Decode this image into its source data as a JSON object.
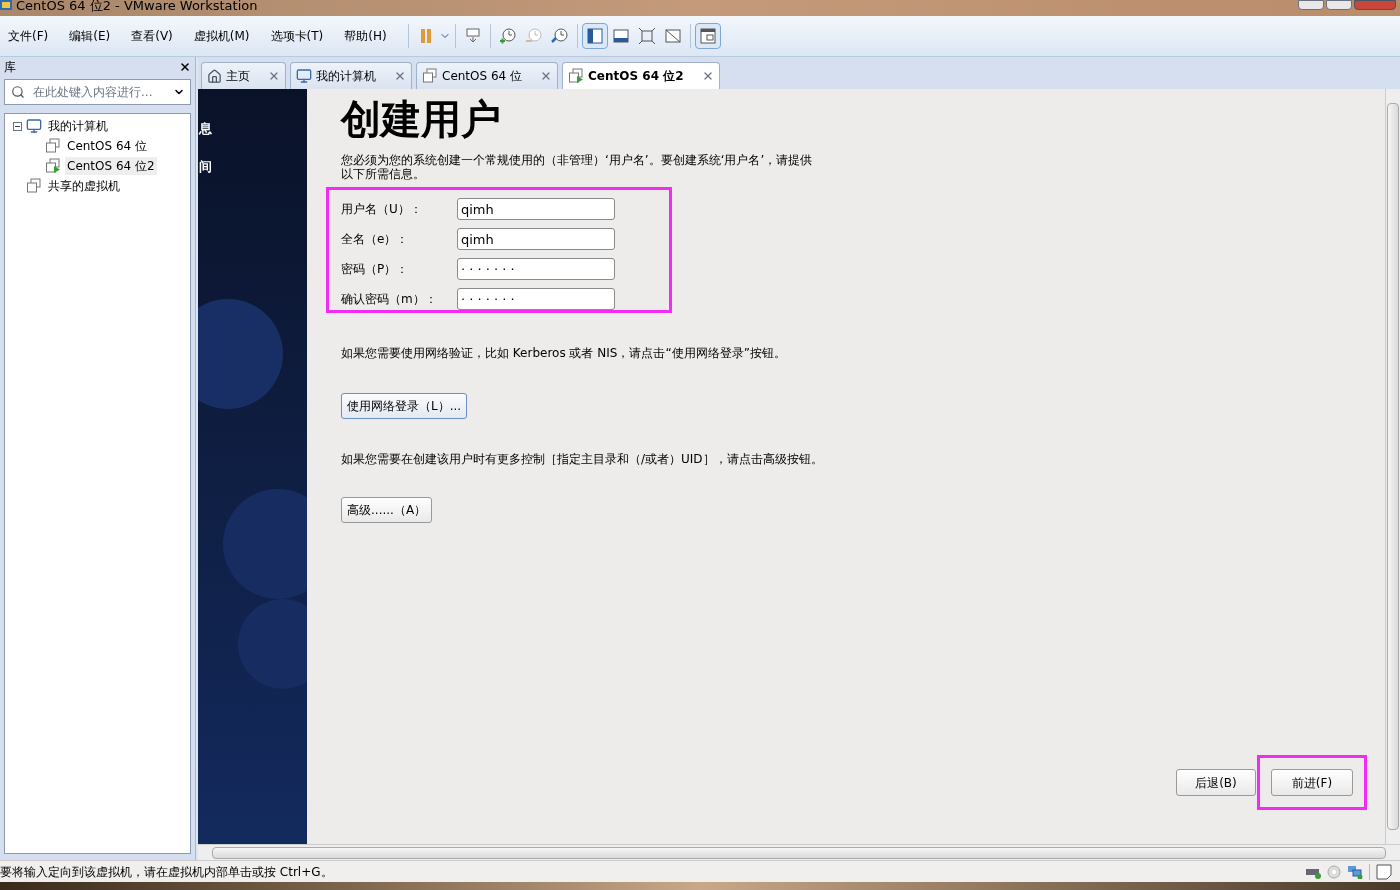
{
  "window": {
    "title": "CentOS 64 位2 - VMware Workstation"
  },
  "menu": [
    "文件(F)",
    "编辑(E)",
    "查看(V)",
    "虚拟机(M)",
    "选项卡(T)",
    "帮助(H)"
  ],
  "library": {
    "title": "库",
    "search": {
      "placeholder": "在此处键入内容进行..."
    },
    "tree": [
      {
        "label": "我的计算机",
        "kind": "computer",
        "expanded": true,
        "selected": false,
        "children": [
          {
            "label": "CentOS 64 位",
            "kind": "vm",
            "selected": false
          },
          {
            "label": "CentOS 64 位2",
            "kind": "vm-running",
            "selected": true
          }
        ]
      },
      {
        "label": "共享的虚拟机",
        "kind": "shared",
        "selected": false
      }
    ]
  },
  "tabs": [
    {
      "label": "主页",
      "kind": "home",
      "selected": false
    },
    {
      "label": "我的计算机",
      "kind": "computer",
      "selected": false
    },
    {
      "label": "CentOS 64 位",
      "kind": "vm",
      "selected": false
    },
    {
      "label": "CentOS 64 位2",
      "kind": "vm-running",
      "selected": true
    }
  ],
  "vm_sidebar": [
    "息",
    "间"
  ],
  "page": {
    "heading": "创建用户",
    "intro": "您必须为您的系统创建一个常规使用的（非管理）‘用户名’。要创建系统‘用户名’，请提供以下所需信息。",
    "fields": [
      {
        "label": "用户名（U）：",
        "value": "qimh"
      },
      {
        "label": "全名（e）：",
        "value": "qimh"
      },
      {
        "label": "密码（P）：",
        "value": "· · · · · · ·"
      },
      {
        "label": "确认密码（m）：",
        "value": "· · · · · · ·"
      }
    ],
    "network_note": "如果您需要使用网络验证，比如 Kerberos 或者 NIS，请点击“使用网络登录”按钮。",
    "network_button": {
      "label": "使用网络登录（L）...",
      "focused": true
    },
    "advanced_note": "如果您需要在创建该用户时有更多控制［指定主目录和（/或者）UID］，请点击高级按钮。",
    "advanced_button": {
      "label": "高级......（A）",
      "focused": false
    },
    "back_button": "后退(B)",
    "next_button": "前进(F)"
  },
  "status_bar": "要将输入定向到该虚拟机，请在虚拟机内部单击或按 Ctrl+G。"
}
